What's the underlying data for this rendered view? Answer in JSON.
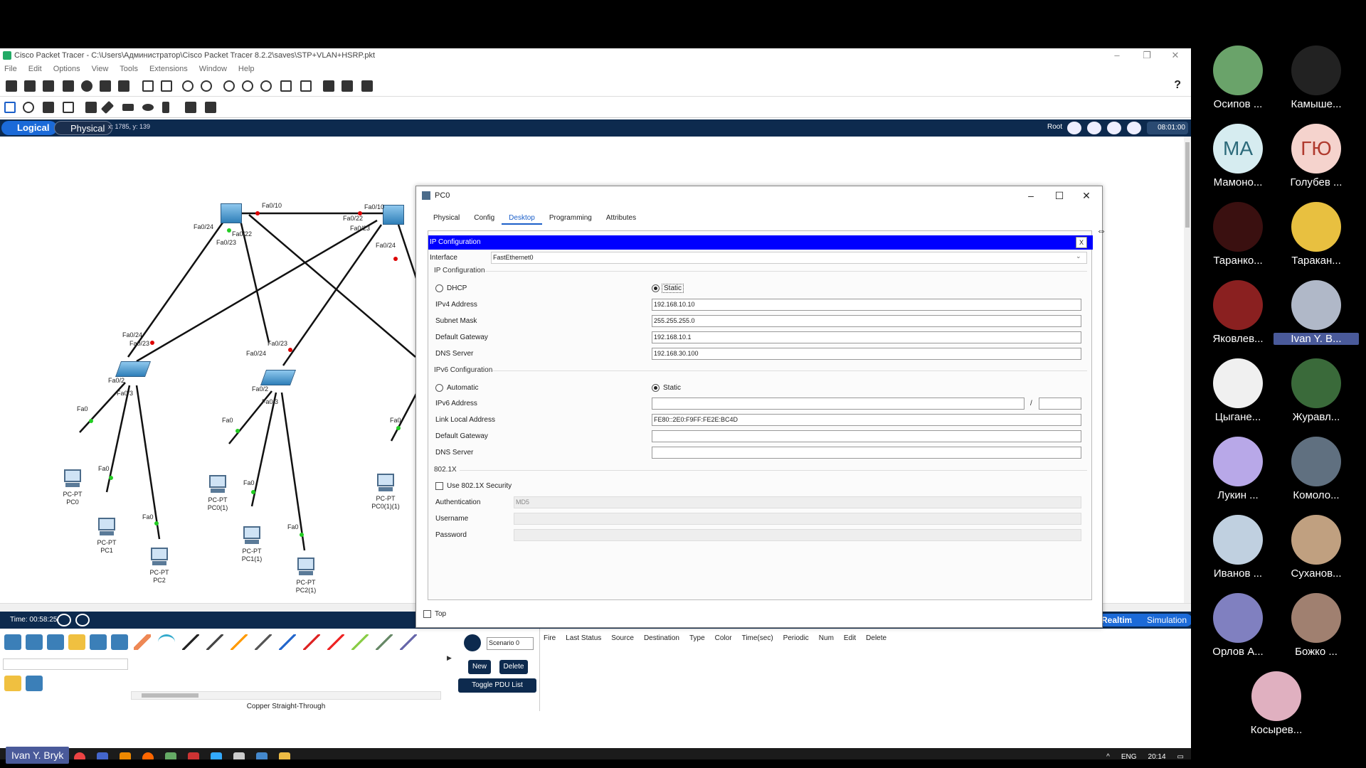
{
  "window": {
    "title": "Cisco Packet Tracer - C:\\Users\\Администратор\\Cisco Packet Tracer 8.2.2\\saves\\STP+VLAN+HSRP.pkt"
  },
  "menu": [
    "File",
    "Edit",
    "Options",
    "View",
    "Tools",
    "Extensions",
    "Window",
    "Help"
  ],
  "viewbar": {
    "logical": "Logical",
    "physical": "Physical",
    "coords": "x: 1785, y: 139",
    "root": "Root",
    "clock": "08:01:00"
  },
  "topology": {
    "labels": [
      {
        "text": "Fa0/10"
      },
      {
        "text": "Fa0/10"
      },
      {
        "text": "Fa0/24"
      },
      {
        "text": "Fa0/22"
      },
      {
        "text": "Fa0/23"
      },
      {
        "text": "Fa0/22"
      },
      {
        "text": "Fa0/23"
      },
      {
        "text": "Fa0/24"
      },
      {
        "text": "Fa0/24"
      },
      {
        "text": "Fa0/23"
      },
      {
        "text": "Fa0/23"
      },
      {
        "text": "Fa0/24"
      },
      {
        "text": "Fa0/2"
      },
      {
        "text": "Fa0/3"
      },
      {
        "text": "Fa0/2"
      },
      {
        "text": "Fa0/3"
      },
      {
        "text": "Fa0"
      },
      {
        "text": "Fa0"
      },
      {
        "text": "Fa0"
      },
      {
        "text": "Fa0"
      },
      {
        "text": "Fa0"
      },
      {
        "text": "Fa0"
      },
      {
        "text": "Fa0"
      }
    ],
    "pcs": [
      {
        "type": "PC-PT",
        "name": "PC0"
      },
      {
        "type": "PC-PT",
        "name": "PC1"
      },
      {
        "type": "PC-PT",
        "name": "PC2"
      },
      {
        "type": "PC-PT",
        "name": "PC0(1)"
      },
      {
        "type": "PC-PT",
        "name": "PC1(1)"
      },
      {
        "type": "PC-PT",
        "name": "PC2(1)"
      },
      {
        "type": "PC-PT",
        "name": "PC0(1)(1)"
      }
    ]
  },
  "bottom": {
    "time": "Time: 00:58:25",
    "realtime": "Realtime",
    "simulation": "Simulation",
    "cable_name": "Copper Straight-Through",
    "scenario": "Scenario 0",
    "new": "New",
    "delete": "Delete",
    "toggle_pdu": "Toggle PDU List Window",
    "pdu_columns": [
      "Fire",
      "Last Status",
      "Source",
      "Destination",
      "Type",
      "Color",
      "Time(sec)",
      "Periodic",
      "Num",
      "Edit",
      "Delete"
    ]
  },
  "taskbar": {
    "lang": "ENG",
    "time": "20:14"
  },
  "dialog": {
    "title": "PC0",
    "tabs": [
      "Physical",
      "Config",
      "Desktop",
      "Programming",
      "Attributes"
    ],
    "active_tab": "Desktop",
    "header": "IP Configuration",
    "close": "X",
    "interface_label": "Interface",
    "interface_value": "FastEthernet0",
    "ipv4": {
      "section": "IP Configuration",
      "dhcp": "DHCP",
      "static": "Static",
      "address_label": "IPv4 Address",
      "address": "192.168.10.10",
      "mask_label": "Subnet Mask",
      "mask": "255.255.255.0",
      "gateway_label": "Default Gateway",
      "gateway": "192.168.10.1",
      "dns_label": "DNS Server",
      "dns": "192.168.30.100"
    },
    "ipv6": {
      "section": "IPv6 Configuration",
      "automatic": "Automatic",
      "static": "Static",
      "address_label": "IPv6 Address",
      "address": "",
      "slash": "/",
      "prefix": "",
      "link_local_label": "Link Local Address",
      "link_local": "FE80::2E0:F9FF:FE2E:BC4D",
      "gateway_label": "Default Gateway",
      "gateway": "",
      "dns_label": "DNS Server",
      "dns": ""
    },
    "dot1x": {
      "section": "802.1X",
      "use_label": "Use 802.1X Security",
      "auth_label": "Authentication",
      "auth_value": "MD5",
      "user_label": "Username",
      "pass_label": "Password"
    },
    "top_label": "Top"
  },
  "participants": [
    {
      "name": "Осипов ...",
      "color": "#6aa36a",
      "initials": ""
    },
    {
      "name": "Камыше...",
      "color": "#222222",
      "initials": ""
    },
    {
      "name": "Мамоно...",
      "color": "#d6ecf0",
      "initials": "МА",
      "text_color": "#2c6a7a"
    },
    {
      "name": "Голубев ...",
      "color": "#f5d3cd",
      "initials": "ГЮ",
      "text_color": "#b03a2e"
    },
    {
      "name": "Таранко...",
      "color": "#3a1010",
      "initials": ""
    },
    {
      "name": "Таракан...",
      "color": "#e8c040",
      "initials": ""
    },
    {
      "name": "Яковлев...",
      "color": "#8a2020",
      "initials": ""
    },
    {
      "name": "Ivan Y. B...",
      "color": "#b0b8c8",
      "initials": ""
    },
    {
      "name": "Цыгане...",
      "color": "#f0f0f0",
      "initials": ""
    },
    {
      "name": "Журавл...",
      "color": "#3a6a3a",
      "initials": ""
    },
    {
      "name": "Лукин ...",
      "color": "#b8a8e8",
      "initials": ""
    },
    {
      "name": "Комоло...",
      "color": "#607080",
      "initials": ""
    },
    {
      "name": "Иванов ...",
      "color": "#c0d0e0",
      "initials": ""
    },
    {
      "name": "Суханов...",
      "color": "#c0a080",
      "initials": ""
    },
    {
      "name": "Орлов А...",
      "color": "#8080c0",
      "initials": ""
    },
    {
      "name": "Божко ...",
      "color": "#a08070",
      "initials": ""
    },
    {
      "name": "Косырев...",
      "color": "#e0b0c0",
      "initials": ""
    }
  ],
  "speaker": "Ivan Y. Bryk"
}
